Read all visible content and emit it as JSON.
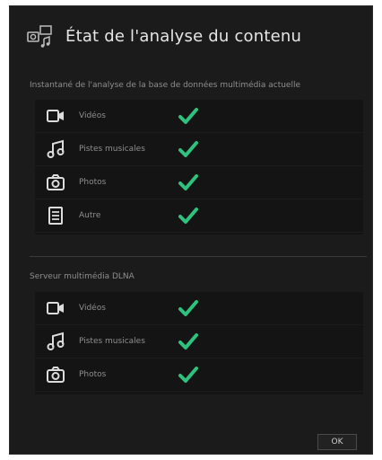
{
  "dialog": {
    "title": "État de l'analyse du contenu",
    "ok_label": "OK",
    "check_color": "#2ec27e"
  },
  "sections": [
    {
      "label": "Instantané de l'analyse de la base de données multimédia actuelle",
      "items": [
        {
          "label": "Vidéos",
          "icon": "video-camera-icon",
          "status": "complete"
        },
        {
          "label": "Pistes musicales",
          "icon": "music-note-icon",
          "status": "complete"
        },
        {
          "label": "Photos",
          "icon": "camera-icon",
          "status": "complete"
        },
        {
          "label": "Autre",
          "icon": "document-icon",
          "status": "complete"
        }
      ]
    },
    {
      "label": "Serveur multimédia DLNA",
      "items": [
        {
          "label": "Vidéos",
          "icon": "video-camera-icon",
          "status": "complete"
        },
        {
          "label": "Pistes musicales",
          "icon": "music-note-icon",
          "status": "complete"
        },
        {
          "label": "Photos",
          "icon": "camera-icon",
          "status": "complete"
        }
      ]
    }
  ]
}
